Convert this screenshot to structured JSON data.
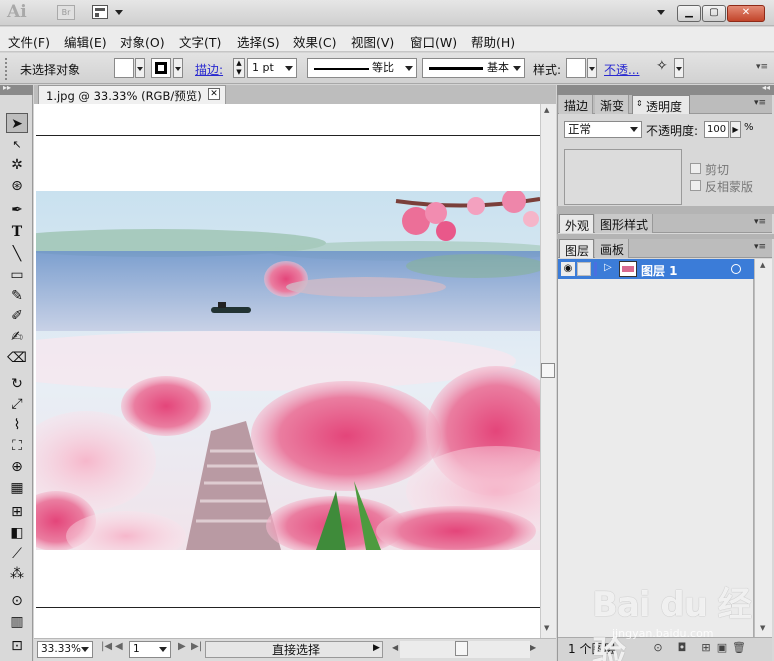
{
  "titlebar": {
    "logo": "Ai",
    "bridge_label": "Br"
  },
  "menu": [
    {
      "label": "文件(F)"
    },
    {
      "label": "编辑(E)"
    },
    {
      "label": "对象(O)"
    },
    {
      "label": "文字(T)"
    },
    {
      "label": "选择(S)"
    },
    {
      "label": "效果(C)"
    },
    {
      "label": "视图(V)"
    },
    {
      "label": "窗口(W)"
    },
    {
      "label": "帮助(H)"
    }
  ],
  "control": {
    "selection_status": "未选择对象",
    "stroke_label": "描边:",
    "stroke_weight": "1 pt",
    "profile_label": "等比",
    "brush_label": "基本",
    "style_label": "样式:",
    "opacity_link": "不透..."
  },
  "document": {
    "tab_title": "1.jpg @ 33.33% (RGB/预览)",
    "close_glyph": "✕"
  },
  "status": {
    "zoom": "33.33%",
    "artboard": "1",
    "current_tool": "直接选择"
  },
  "panels": {
    "top_tabs": [
      {
        "label": "描边"
      },
      {
        "label": "渐变"
      },
      {
        "label": "透明度"
      }
    ],
    "transparency": {
      "blend_mode": "正常",
      "opacity_label": "不透明度:",
      "opacity_value": "100",
      "opacity_unit": "%",
      "clip_label": "剪切",
      "invert_mask_label": "反相蒙版"
    },
    "mid_tabs": [
      {
        "label": "外观"
      },
      {
        "label": "图形样式"
      }
    ],
    "layers_tabs": [
      {
        "label": "图层"
      },
      {
        "label": "画板"
      }
    ],
    "layers": [
      {
        "name": "图层 1"
      }
    ],
    "layer_count": "1 个图层"
  },
  "watermark": {
    "brand": "Bai du 经验",
    "url": "jingyan.baidu.com"
  },
  "colors": {
    "layer_selected": "#3b7cd8",
    "layer_color_bar": "#4a6fe0"
  }
}
